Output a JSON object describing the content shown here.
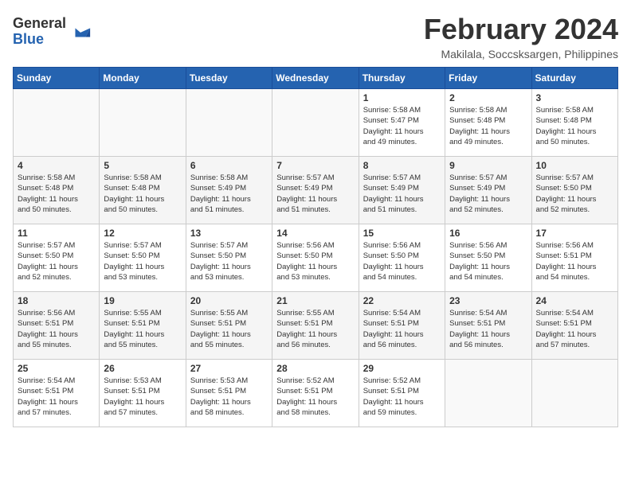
{
  "header": {
    "logo": {
      "general": "General",
      "blue": "Blue"
    },
    "month_title": "February 2024",
    "location": "Makilala, Soccsksargen, Philippines"
  },
  "days_of_week": [
    "Sunday",
    "Monday",
    "Tuesday",
    "Wednesday",
    "Thursday",
    "Friday",
    "Saturday"
  ],
  "weeks": [
    [
      {
        "day": "",
        "info": ""
      },
      {
        "day": "",
        "info": ""
      },
      {
        "day": "",
        "info": ""
      },
      {
        "day": "",
        "info": ""
      },
      {
        "day": "1",
        "info": "Sunrise: 5:58 AM\nSunset: 5:47 PM\nDaylight: 11 hours\nand 49 minutes."
      },
      {
        "day": "2",
        "info": "Sunrise: 5:58 AM\nSunset: 5:48 PM\nDaylight: 11 hours\nand 49 minutes."
      },
      {
        "day": "3",
        "info": "Sunrise: 5:58 AM\nSunset: 5:48 PM\nDaylight: 11 hours\nand 50 minutes."
      }
    ],
    [
      {
        "day": "4",
        "info": "Sunrise: 5:58 AM\nSunset: 5:48 PM\nDaylight: 11 hours\nand 50 minutes."
      },
      {
        "day": "5",
        "info": "Sunrise: 5:58 AM\nSunset: 5:48 PM\nDaylight: 11 hours\nand 50 minutes."
      },
      {
        "day": "6",
        "info": "Sunrise: 5:58 AM\nSunset: 5:49 PM\nDaylight: 11 hours\nand 51 minutes."
      },
      {
        "day": "7",
        "info": "Sunrise: 5:57 AM\nSunset: 5:49 PM\nDaylight: 11 hours\nand 51 minutes."
      },
      {
        "day": "8",
        "info": "Sunrise: 5:57 AM\nSunset: 5:49 PM\nDaylight: 11 hours\nand 51 minutes."
      },
      {
        "day": "9",
        "info": "Sunrise: 5:57 AM\nSunset: 5:49 PM\nDaylight: 11 hours\nand 52 minutes."
      },
      {
        "day": "10",
        "info": "Sunrise: 5:57 AM\nSunset: 5:50 PM\nDaylight: 11 hours\nand 52 minutes."
      }
    ],
    [
      {
        "day": "11",
        "info": "Sunrise: 5:57 AM\nSunset: 5:50 PM\nDaylight: 11 hours\nand 52 minutes."
      },
      {
        "day": "12",
        "info": "Sunrise: 5:57 AM\nSunset: 5:50 PM\nDaylight: 11 hours\nand 53 minutes."
      },
      {
        "day": "13",
        "info": "Sunrise: 5:57 AM\nSunset: 5:50 PM\nDaylight: 11 hours\nand 53 minutes."
      },
      {
        "day": "14",
        "info": "Sunrise: 5:56 AM\nSunset: 5:50 PM\nDaylight: 11 hours\nand 53 minutes."
      },
      {
        "day": "15",
        "info": "Sunrise: 5:56 AM\nSunset: 5:50 PM\nDaylight: 11 hours\nand 54 minutes."
      },
      {
        "day": "16",
        "info": "Sunrise: 5:56 AM\nSunset: 5:50 PM\nDaylight: 11 hours\nand 54 minutes."
      },
      {
        "day": "17",
        "info": "Sunrise: 5:56 AM\nSunset: 5:51 PM\nDaylight: 11 hours\nand 54 minutes."
      }
    ],
    [
      {
        "day": "18",
        "info": "Sunrise: 5:56 AM\nSunset: 5:51 PM\nDaylight: 11 hours\nand 55 minutes."
      },
      {
        "day": "19",
        "info": "Sunrise: 5:55 AM\nSunset: 5:51 PM\nDaylight: 11 hours\nand 55 minutes."
      },
      {
        "day": "20",
        "info": "Sunrise: 5:55 AM\nSunset: 5:51 PM\nDaylight: 11 hours\nand 55 minutes."
      },
      {
        "day": "21",
        "info": "Sunrise: 5:55 AM\nSunset: 5:51 PM\nDaylight: 11 hours\nand 56 minutes."
      },
      {
        "day": "22",
        "info": "Sunrise: 5:54 AM\nSunset: 5:51 PM\nDaylight: 11 hours\nand 56 minutes."
      },
      {
        "day": "23",
        "info": "Sunrise: 5:54 AM\nSunset: 5:51 PM\nDaylight: 11 hours\nand 56 minutes."
      },
      {
        "day": "24",
        "info": "Sunrise: 5:54 AM\nSunset: 5:51 PM\nDaylight: 11 hours\nand 57 minutes."
      }
    ],
    [
      {
        "day": "25",
        "info": "Sunrise: 5:54 AM\nSunset: 5:51 PM\nDaylight: 11 hours\nand 57 minutes."
      },
      {
        "day": "26",
        "info": "Sunrise: 5:53 AM\nSunset: 5:51 PM\nDaylight: 11 hours\nand 57 minutes."
      },
      {
        "day": "27",
        "info": "Sunrise: 5:53 AM\nSunset: 5:51 PM\nDaylight: 11 hours\nand 58 minutes."
      },
      {
        "day": "28",
        "info": "Sunrise: 5:52 AM\nSunset: 5:51 PM\nDaylight: 11 hours\nand 58 minutes."
      },
      {
        "day": "29",
        "info": "Sunrise: 5:52 AM\nSunset: 5:51 PM\nDaylight: 11 hours\nand 59 minutes."
      },
      {
        "day": "",
        "info": ""
      },
      {
        "day": "",
        "info": ""
      }
    ]
  ]
}
